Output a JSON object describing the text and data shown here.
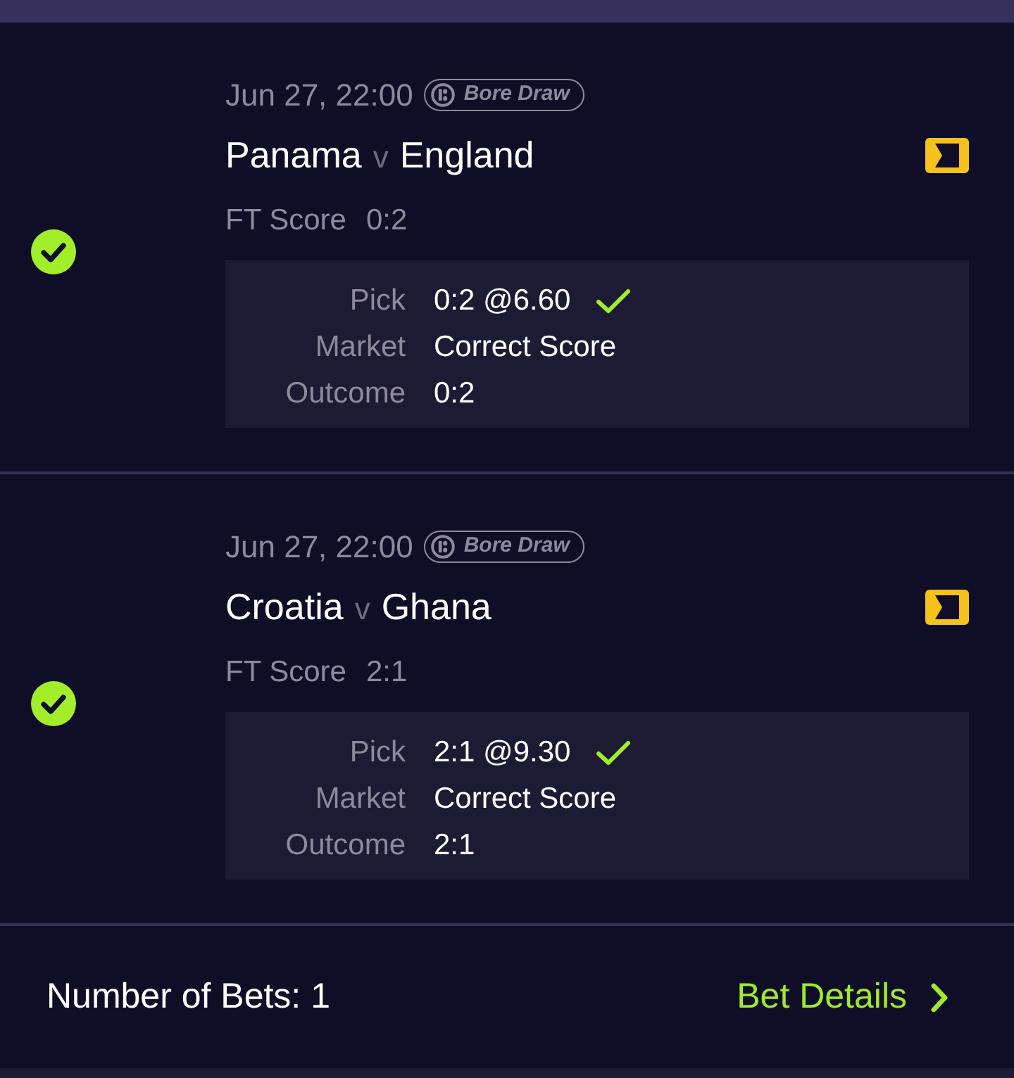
{
  "matches": [
    {
      "won": true,
      "date": "Jun 27, 22:00",
      "tag": "Bore Draw",
      "home": "Panama",
      "separator": "v",
      "away": "England",
      "score_label": "FT Score",
      "score": "0:2",
      "pick": {
        "label": "Pick",
        "value": "0:2 @6.60",
        "won": true
      },
      "market": {
        "label": "Market",
        "value": "Correct Score"
      },
      "outcome": {
        "label": "Outcome",
        "value": "0:2"
      }
    },
    {
      "won": true,
      "date": "Jun 27, 22:00",
      "tag": "Bore Draw",
      "home": "Croatia",
      "separator": "v",
      "away": "Ghana",
      "score_label": "FT Score",
      "score": "2:1",
      "pick": {
        "label": "Pick",
        "value": "2:1 @9.30",
        "won": true
      },
      "market": {
        "label": "Market",
        "value": "Correct Score"
      },
      "outcome": {
        "label": "Outcome",
        "value": "2:1"
      }
    }
  ],
  "footer": {
    "bets_count": "Number of Bets: 1",
    "details_link": "Bet Details"
  }
}
